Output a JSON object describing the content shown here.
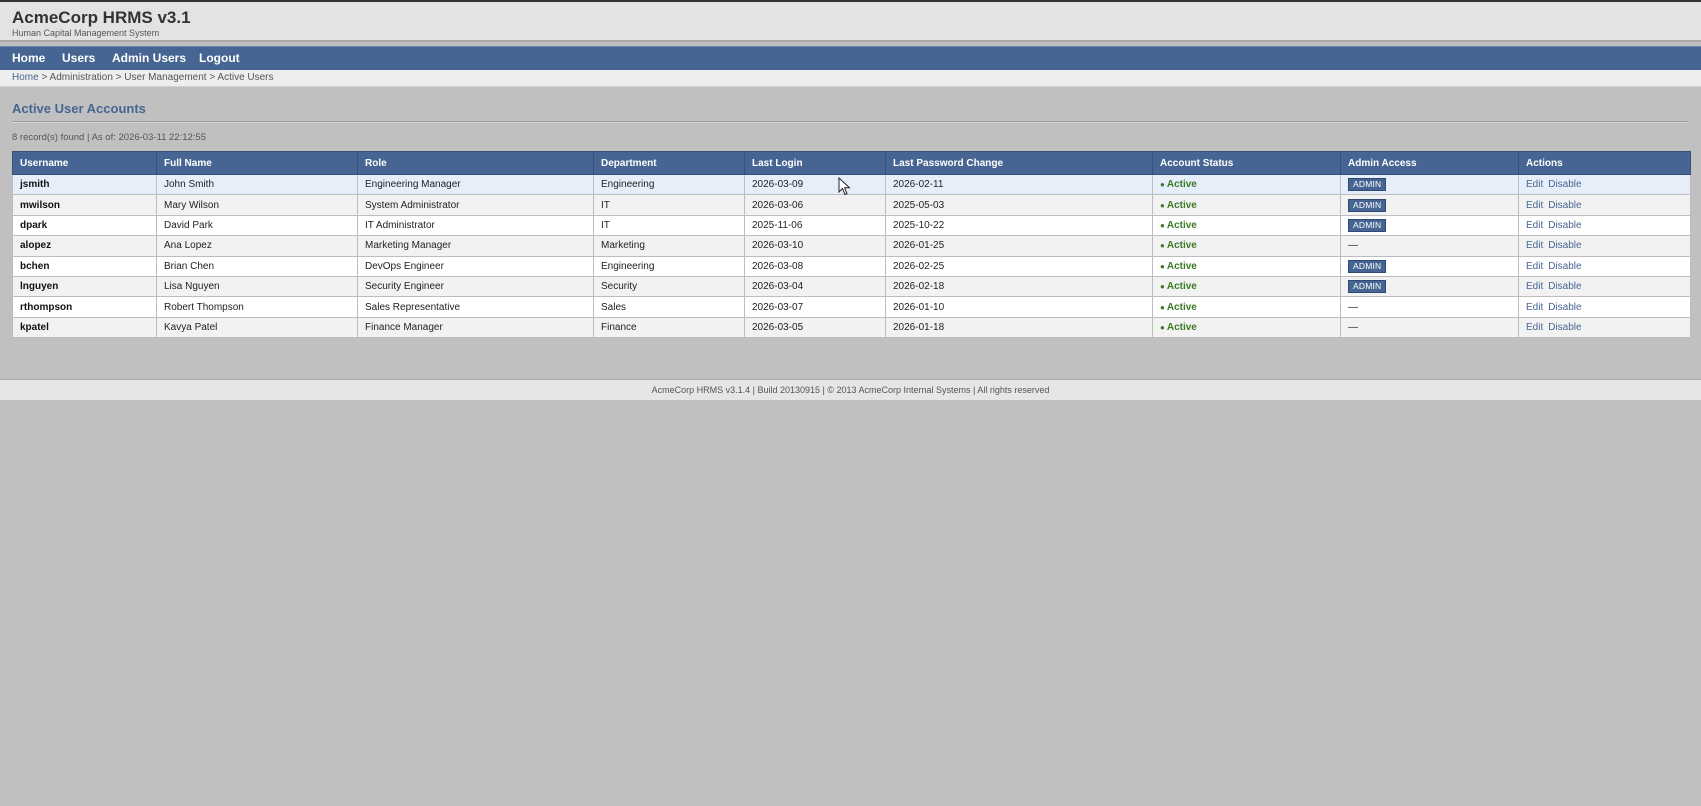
{
  "header": {
    "title": "AcmeCorp HRMS v3.1",
    "subtitle": "Human Capital Management System"
  },
  "nav": {
    "items": [
      {
        "label": "Home"
      },
      {
        "label": "Users"
      },
      {
        "label": "Admin Users"
      },
      {
        "label": "Logout"
      }
    ]
  },
  "breadcrumb": {
    "home": "Home",
    "rest": " > Administration > User Management > Active Users"
  },
  "page": {
    "heading": "Active User Accounts",
    "record_info": "8 record(s) found | As of: 2026-03-11 22:12:55"
  },
  "table": {
    "columns": [
      "Username",
      "Full Name",
      "Role",
      "Department",
      "Last Login",
      "Last Password Change",
      "Account Status",
      "Admin Access",
      "Actions"
    ],
    "rows": [
      {
        "username": "jsmith",
        "full_name": "John Smith",
        "role": "Engineering Manager",
        "department": "Engineering",
        "last_login": "2026-03-09",
        "last_pw_change": "2026-02-11",
        "status": "Active",
        "admin": "ADMIN"
      },
      {
        "username": "mwilson",
        "full_name": "Mary Wilson",
        "role": "System Administrator",
        "department": "IT",
        "last_login": "2026-03-06",
        "last_pw_change": "2025-05-03",
        "status": "Active",
        "admin": "ADMIN"
      },
      {
        "username": "dpark",
        "full_name": "David Park",
        "role": "IT Administrator",
        "department": "IT",
        "last_login": "2025-11-06",
        "last_pw_change": "2025-10-22",
        "status": "Active",
        "admin": "ADMIN"
      },
      {
        "username": "alopez",
        "full_name": "Ana Lopez",
        "role": "Marketing Manager",
        "department": "Marketing",
        "last_login": "2026-03-10",
        "last_pw_change": "2026-01-25",
        "status": "Active",
        "admin": "—"
      },
      {
        "username": "bchen",
        "full_name": "Brian Chen",
        "role": "DevOps Engineer",
        "department": "Engineering",
        "last_login": "2026-03-08",
        "last_pw_change": "2026-02-25",
        "status": "Active",
        "admin": "ADMIN"
      },
      {
        "username": "lnguyen",
        "full_name": "Lisa Nguyen",
        "role": "Security Engineer",
        "department": "Security",
        "last_login": "2026-03-04",
        "last_pw_change": "2026-02-18",
        "status": "Active",
        "admin": "ADMIN"
      },
      {
        "username": "rthompson",
        "full_name": "Robert Thompson",
        "role": "Sales Representative",
        "department": "Sales",
        "last_login": "2026-03-07",
        "last_pw_change": "2026-01-10",
        "status": "Active",
        "admin": "—"
      },
      {
        "username": "kpatel",
        "full_name": "Kavya Patel",
        "role": "Finance Manager",
        "department": "Finance",
        "last_login": "2026-03-05",
        "last_pw_change": "2026-01-18",
        "status": "Active",
        "admin": "—"
      }
    ],
    "actions": {
      "edit": "Edit",
      "disable": "Disable"
    }
  },
  "footer": {
    "text": "AcmeCorp HRMS v3.1.4 | Build 20130915 | © 2013 AcmeCorp Internal Systems | All rights reserved"
  },
  "colors": {
    "nav_bg": "#476592",
    "status_active": "#3b7a25",
    "page_bg": "#c0c0c0"
  },
  "icons": {
    "status_dot": "●",
    "cursor": "mouse-cursor-icon"
  }
}
